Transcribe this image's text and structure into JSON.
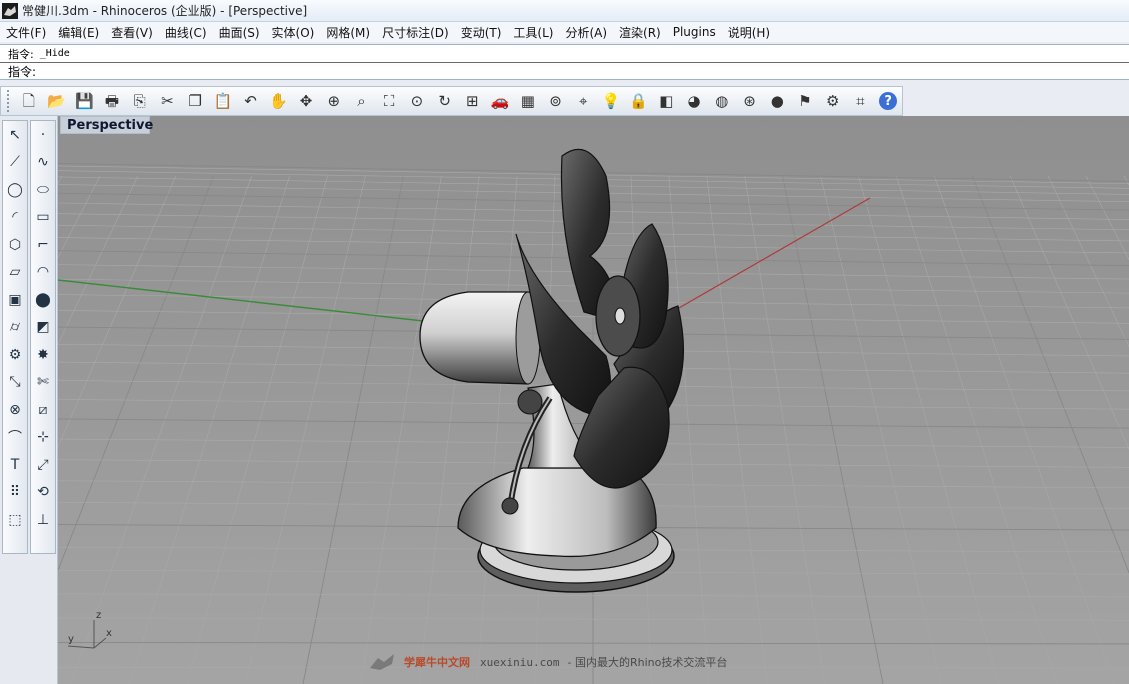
{
  "window": {
    "title": "常健川.3dm - Rhinoceros (企业版) - [Perspective]",
    "icon": "rhino-icon"
  },
  "menu": [
    "文件(F)",
    "编辑(E)",
    "查看(V)",
    "曲线(C)",
    "曲面(S)",
    "实体(O)",
    "网格(M)",
    "尺寸标注(D)",
    "变动(T)",
    "工具(L)",
    "分析(A)",
    "渲染(R)",
    "Plugins",
    "说明(H)"
  ],
  "command": {
    "history_label": "指令:",
    "history_value": "_Hide",
    "prompt_label": "指令:",
    "input_value": ""
  },
  "toolbar": {
    "icons": [
      "new-file-icon",
      "open-folder-icon",
      "save-icon",
      "print-icon",
      "import-icon",
      "cut-icon",
      "copy-icon",
      "paste-icon",
      "undo-icon",
      "pan-hand-icon",
      "rotate-view-icon",
      "zoom-icon",
      "zoom-window-icon",
      "zoom-extents-icon",
      "zoom-selected-icon",
      "rotate-icon",
      "viewport-layout-icon",
      "car-icon",
      "grid-icon",
      "osnap-icon",
      "select-filter-icon",
      "light-icon",
      "lock-icon",
      "layer-icon",
      "color-wheel-icon",
      "sphere-wire-icon",
      "mesh-sphere-icon",
      "render-sphere-icon",
      "render-settings-icon",
      "gear-options-icon",
      "cplane-icon",
      "help-icon"
    ]
  },
  "left_toolbar": {
    "col1": [
      "select-arrow-icon",
      "polyline-icon",
      "circle-icon",
      "arc-icon",
      "polygon-icon",
      "surface-icon",
      "box-solid-icon",
      "cylinder-icon",
      "tools-gear-icon",
      "transform-icon",
      "boolean-icon",
      "curve-fillet-icon",
      "text-icon",
      "array-icon",
      "render-box-icon"
    ],
    "col2": [
      "point-icon",
      "curve-icon",
      "ellipse-icon",
      "rectangle-icon",
      "fillet-curve-icon",
      "revolve-icon",
      "sphere-solid-icon",
      "sweep-surface-icon",
      "explode-icon",
      "trim-icon",
      "split-icon",
      "analyze-icon",
      "scale-icon",
      "history-icon",
      "dimension-icon"
    ]
  },
  "viewport": {
    "tab_label": "Perspective",
    "axis_labels": {
      "z": "z",
      "y": "y",
      "x": "x"
    }
  },
  "watermark": {
    "brand": "学犀牛中文网",
    "url": "xuexiniu.com",
    "slogan": "- 国内最大的Rhino技术交流平台"
  }
}
